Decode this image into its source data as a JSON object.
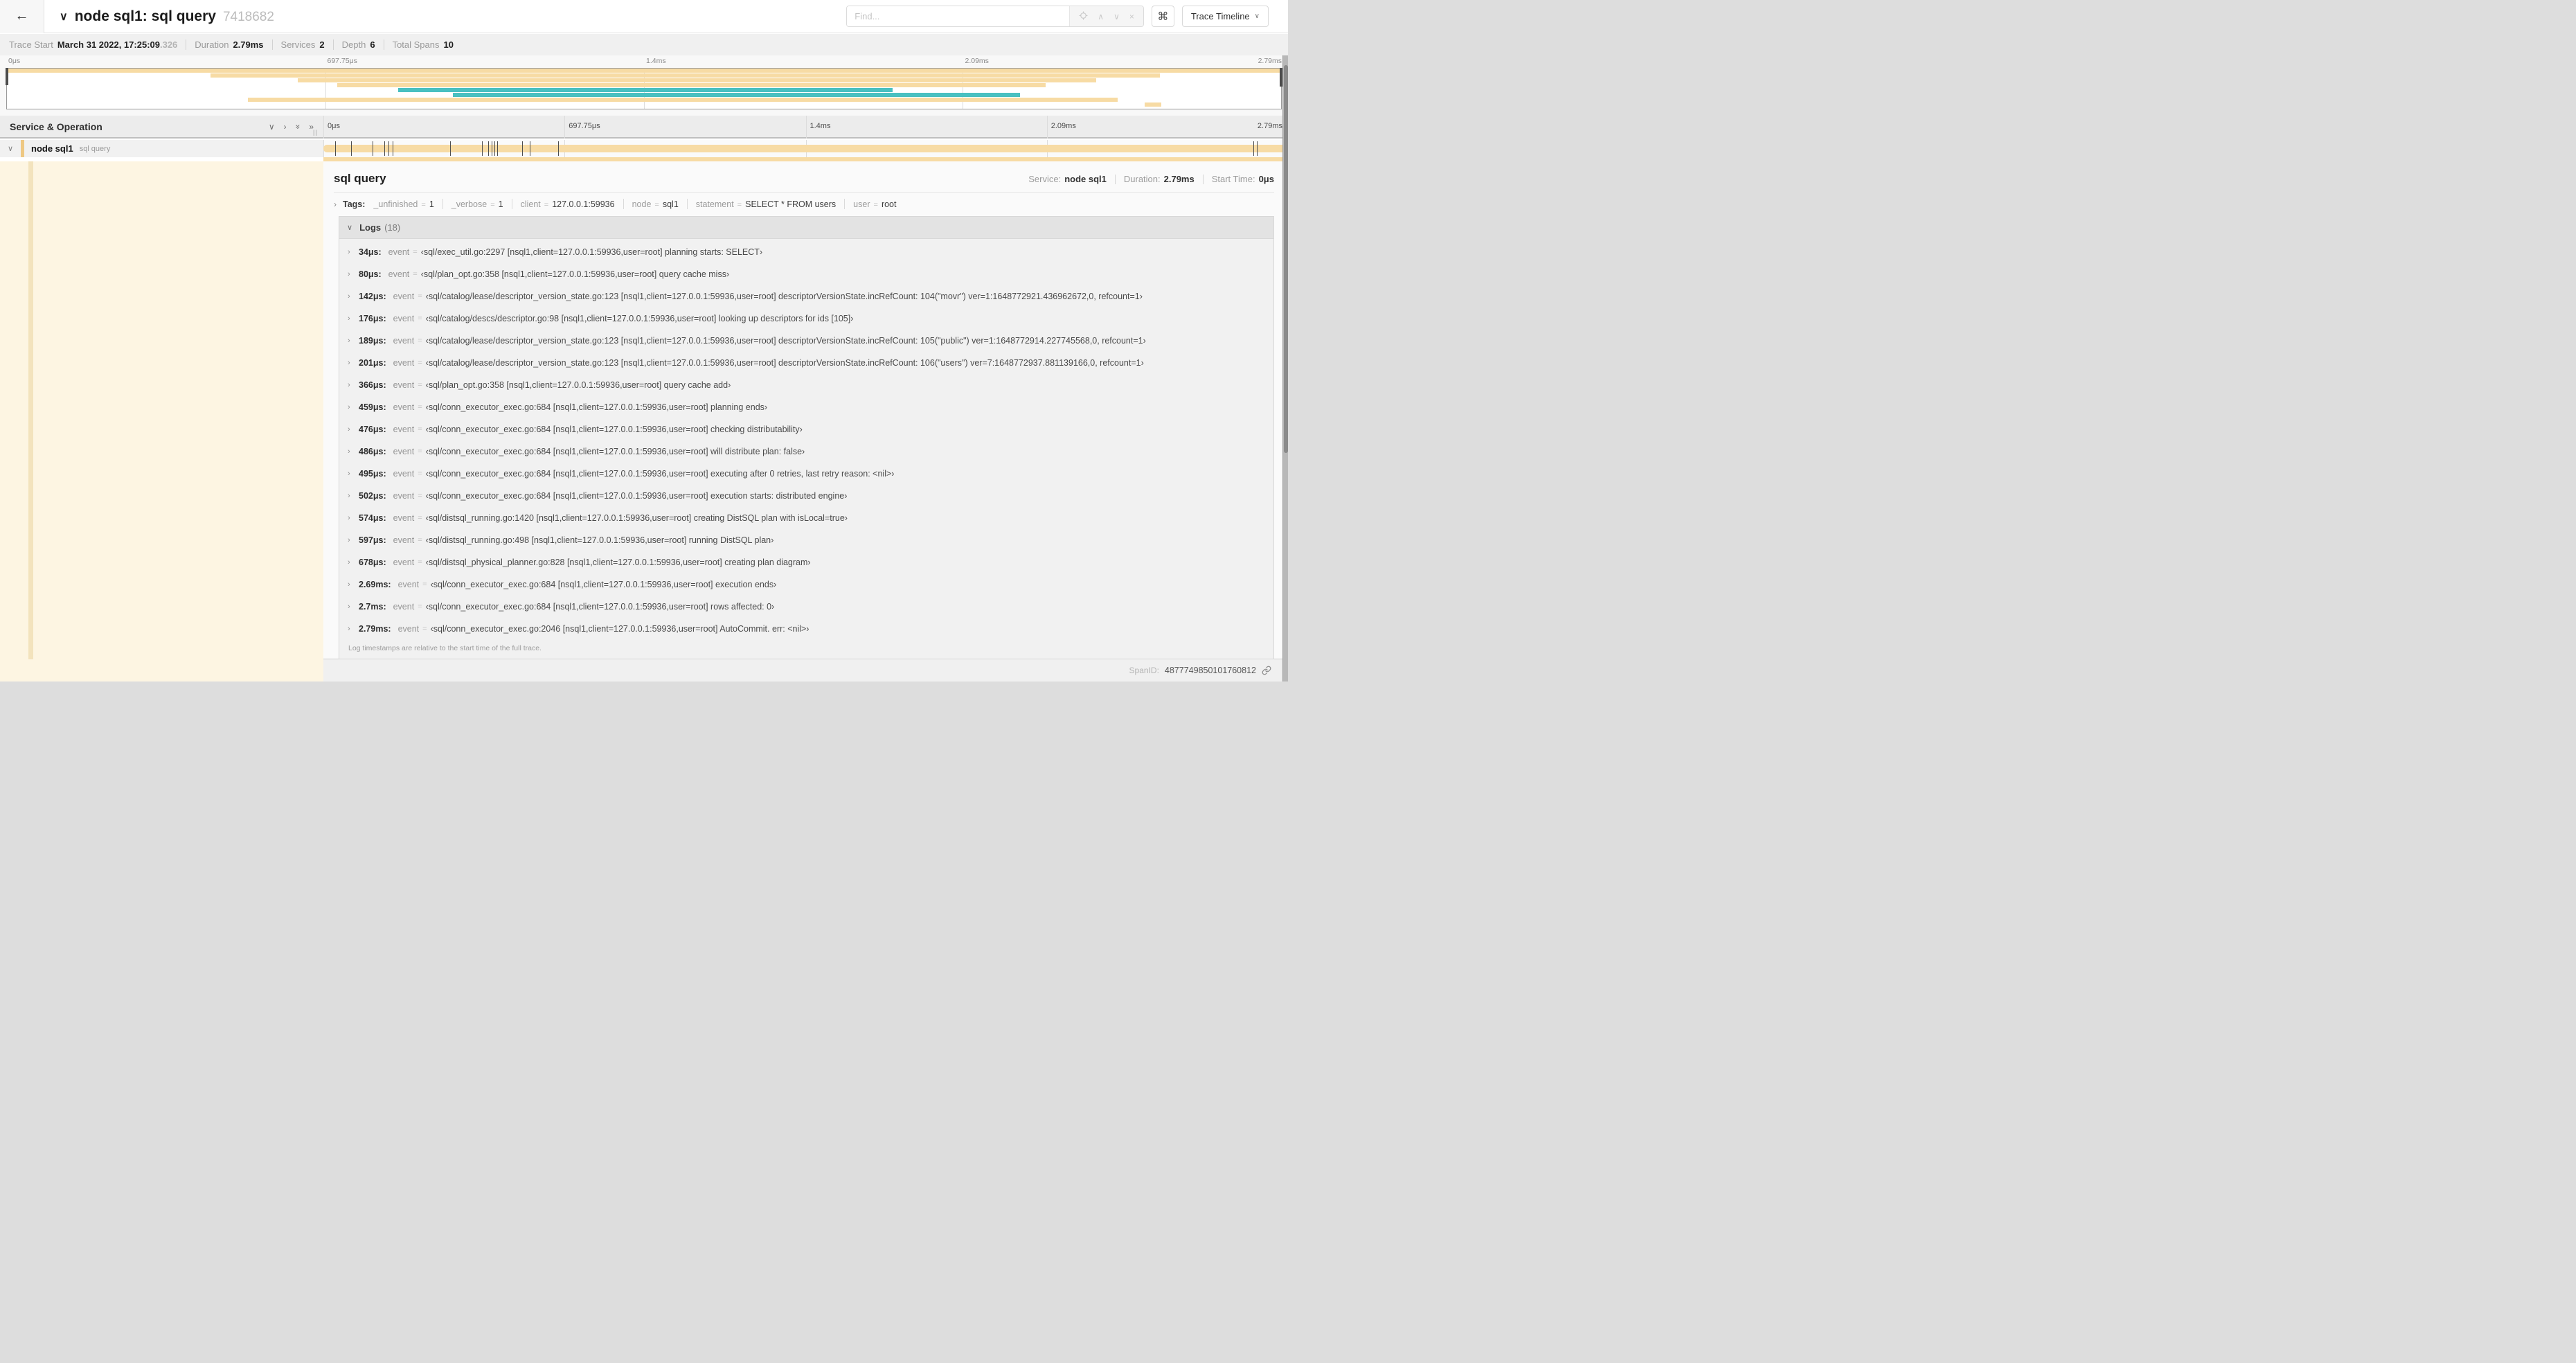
{
  "header": {
    "back_icon": "←",
    "collapse_caret": "∨",
    "title": "node sql1: sql query",
    "trace_id": "7418682",
    "find_placeholder": "Find...",
    "shortcut_icon": "⌘",
    "view_selector_label": "Trace Timeline",
    "view_selector_caret": "∨"
  },
  "summary": {
    "items": [
      {
        "label": "Trace Start",
        "value": "March 31 2022, 17:25:09",
        "suffix": ".326"
      },
      {
        "label": "Duration",
        "value": "2.79ms"
      },
      {
        "label": "Services",
        "value": "2"
      },
      {
        "label": "Depth",
        "value": "6"
      },
      {
        "label": "Total Spans",
        "value": "10"
      }
    ]
  },
  "timeline": {
    "axis_labels": [
      "0μs",
      "697.75μs",
      "1.4ms",
      "2.09ms",
      "2.79ms"
    ],
    "duration_us": 2790,
    "colors": {
      "orange": "#f7dba4",
      "teal": "#49c0c1",
      "cream": "#fdf5e2",
      "cream_stripe": "#f3e3bd"
    },
    "minimap_rows": [
      {
        "start": 0.0,
        "end": 1.0,
        "color": "orange"
      },
      {
        "start": 0.16,
        "end": 0.905,
        "color": "orange"
      },
      {
        "start": 0.228,
        "end": 0.855,
        "color": "orange"
      },
      {
        "start": 0.259,
        "end": 0.815,
        "color": "orange"
      },
      {
        "start": 0.307,
        "end": 0.695,
        "color": "teal"
      },
      {
        "start": 0.35,
        "end": 0.795,
        "color": "teal"
      },
      {
        "start": 0.189,
        "end": 0.872,
        "color": "orange"
      },
      {
        "start": 0.893,
        "end": 0.906,
        "color": "orange"
      }
    ]
  },
  "span_list": {
    "header_title": "Service & Operation",
    "icons": {
      "collapse_one": "∨",
      "expand_one": "›",
      "collapse_all": "»",
      "expand_all": "»"
    }
  },
  "span_row": {
    "caret": "∨",
    "service": "node sql1",
    "operation": "sql query",
    "tick_times_us": [
      34,
      80,
      142,
      176,
      189,
      201,
      366,
      459,
      476,
      486,
      495,
      502,
      574,
      597,
      678,
      2690,
      2700
    ]
  },
  "detail": {
    "operation": "sql query",
    "service_label": "Service:",
    "service": "node sql1",
    "duration_label": "Duration:",
    "duration": "2.79ms",
    "start_label": "Start Time:",
    "start": "0μs",
    "tags_chevron": "›",
    "tags_label": "Tags:",
    "tags": [
      {
        "key": "_unfinished",
        "value": "1"
      },
      {
        "key": "_verbose",
        "value": "1"
      },
      {
        "key": "client",
        "value": "127.0.0.1:59936"
      },
      {
        "key": "node",
        "value": "sql1"
      },
      {
        "key": "statement",
        "value": "SELECT * FROM users"
      },
      {
        "key": "user",
        "value": "root"
      }
    ],
    "logs_chevron": "∨",
    "logs_label": "Logs",
    "logs_count": "(18)",
    "logs": [
      {
        "t": "34μs",
        "key": "event",
        "value": "‹sql/exec_util.go:2297 [nsql1,client=127.0.0.1:59936,user=root] planning starts: SELECT›"
      },
      {
        "t": "80μs",
        "key": "event",
        "value": "‹sql/plan_opt.go:358 [nsql1,client=127.0.0.1:59936,user=root] query cache miss›"
      },
      {
        "t": "142μs",
        "key": "event",
        "value": "‹sql/catalog/lease/descriptor_version_state.go:123 [nsql1,client=127.0.0.1:59936,user=root] descriptorVersionState.incRefCount: 104(\"movr\") ver=1:1648772921.436962672,0, refcount=1›"
      },
      {
        "t": "176μs",
        "key": "event",
        "value": "‹sql/catalog/descs/descriptor.go:98 [nsql1,client=127.0.0.1:59936,user=root] looking up descriptors for ids [105]›"
      },
      {
        "t": "189μs",
        "key": "event",
        "value": "‹sql/catalog/lease/descriptor_version_state.go:123 [nsql1,client=127.0.0.1:59936,user=root] descriptorVersionState.incRefCount: 105(\"public\") ver=1:1648772914.227745568,0, refcount=1›"
      },
      {
        "t": "201μs",
        "key": "event",
        "value": "‹sql/catalog/lease/descriptor_version_state.go:123 [nsql1,client=127.0.0.1:59936,user=root] descriptorVersionState.incRefCount: 106(\"users\") ver=7:1648772937.881139166,0, refcount=1›"
      },
      {
        "t": "366μs",
        "key": "event",
        "value": "‹sql/plan_opt.go:358 [nsql1,client=127.0.0.1:59936,user=root] query cache add›"
      },
      {
        "t": "459μs",
        "key": "event",
        "value": "‹sql/conn_executor_exec.go:684 [nsql1,client=127.0.0.1:59936,user=root] planning ends›"
      },
      {
        "t": "476μs",
        "key": "event",
        "value": "‹sql/conn_executor_exec.go:684 [nsql1,client=127.0.0.1:59936,user=root] checking distributability›"
      },
      {
        "t": "486μs",
        "key": "event",
        "value": "‹sql/conn_executor_exec.go:684 [nsql1,client=127.0.0.1:59936,user=root] will distribute plan: false›"
      },
      {
        "t": "495μs",
        "key": "event",
        "value": "‹sql/conn_executor_exec.go:684 [nsql1,client=127.0.0.1:59936,user=root] executing after 0 retries, last retry reason: <nil>›"
      },
      {
        "t": "502μs",
        "key": "event",
        "value": "‹sql/conn_executor_exec.go:684 [nsql1,client=127.0.0.1:59936,user=root] execution starts: distributed engine›"
      },
      {
        "t": "574μs",
        "key": "event",
        "value": "‹sql/distsql_running.go:1420 [nsql1,client=127.0.0.1:59936,user=root] creating DistSQL plan with isLocal=true›"
      },
      {
        "t": "597μs",
        "key": "event",
        "value": "‹sql/distsql_running.go:498 [nsql1,client=127.0.0.1:59936,user=root] running DistSQL plan›"
      },
      {
        "t": "678μs",
        "key": "event",
        "value": "‹sql/distsql_physical_planner.go:828 [nsql1,client=127.0.0.1:59936,user=root] creating plan diagram›"
      },
      {
        "t": "2.69ms",
        "key": "event",
        "value": "‹sql/conn_executor_exec.go:684 [nsql1,client=127.0.0.1:59936,user=root] execution ends›"
      },
      {
        "t": "2.7ms",
        "key": "event",
        "value": "‹sql/conn_executor_exec.go:684 [nsql1,client=127.0.0.1:59936,user=root] rows affected: 0›"
      },
      {
        "t": "2.79ms",
        "key": "event",
        "value": "‹sql/conn_executor_exec.go:2046 [nsql1,client=127.0.0.1:59936,user=root] AutoCommit. err: <nil>›"
      }
    ],
    "footnote": "Log timestamps are relative to the start time of the full trace.",
    "span_id_label": "SpanID:",
    "span_id": "4877749850101760812"
  }
}
